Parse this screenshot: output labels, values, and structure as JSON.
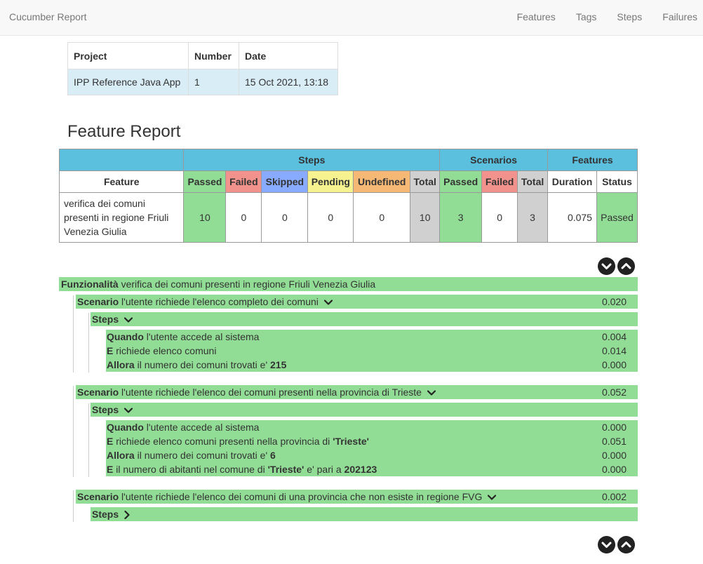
{
  "nav": {
    "brand": "Cucumber Report",
    "links": [
      "Features",
      "Tags",
      "Steps",
      "Failures"
    ]
  },
  "info": {
    "headers": [
      "Project",
      "Number",
      "Date"
    ],
    "row": [
      "IPP Reference Java App",
      "1",
      "15 Oct 2021, 13:18"
    ]
  },
  "report_title": "Feature Report",
  "stats": {
    "groups": [
      "Steps",
      "Scenarios",
      "Features"
    ],
    "headers": [
      "Feature",
      "Passed",
      "Failed",
      "Skipped",
      "Pending",
      "Undefined",
      "Total",
      "Passed",
      "Failed",
      "Total",
      "Duration",
      "Status"
    ],
    "row": [
      "verifica dei comuni presenti in regione Friuli Venezia Giulia",
      "10",
      "0",
      "0",
      "0",
      "0",
      "10",
      "3",
      "0",
      "3",
      "0.075",
      "Passed"
    ]
  },
  "feature": {
    "keyword": "Funzionalità",
    "name": "verifica dei comuni presenti in regione Friuli Venezia Giulia"
  },
  "scenarios": [
    {
      "keyword": "Scenario",
      "name": "l'utente richiede l'elenco completo dei comuni",
      "duration": "0.020",
      "steps_label": "Steps",
      "steps": [
        {
          "keyword": "Quando",
          "text": "l'utente accede al sistema",
          "duration": "0.004"
        },
        {
          "keyword": "E",
          "text": "richiede elenco comuni",
          "duration": "0.014"
        },
        {
          "keyword": "Allora",
          "text": "il numero dei comuni trovati e'",
          "arg": "215",
          "duration": "0.000"
        }
      ]
    },
    {
      "keyword": "Scenario",
      "name": "l'utente richiede l'elenco dei comuni presenti nella provincia di Trieste",
      "duration": "0.052",
      "steps_label": "Steps",
      "steps": [
        {
          "keyword": "Quando",
          "text": "l'utente accede al sistema",
          "duration": "0.000"
        },
        {
          "keyword": "E",
          "text": "richiede elenco comuni presenti nella provincia di",
          "arg": "'Trieste'",
          "duration": "0.051"
        },
        {
          "keyword": "Allora",
          "text": "il numero dei comuni trovati e'",
          "arg": "6",
          "duration": "0.000"
        },
        {
          "keyword": "E",
          "text": "il numero di abitanti nel comune di",
          "arg": "'Trieste'",
          "text2": "e' pari a",
          "arg2": "202123",
          "duration": "0.000"
        }
      ]
    },
    {
      "keyword": "Scenario",
      "name": "l'utente richiede l'elenco dei comuni di una provincia che non esiste in regione FVG",
      "duration": "0.002",
      "steps_label": "Steps"
    }
  ],
  "icons": {
    "expand": "chevron-circle-down-icon",
    "collapse": "chevron-circle-up-icon"
  },
  "colors": {
    "passed": "#92dd96",
    "failed": "#f2928c",
    "skipped": "#88aaff",
    "pending": "#f5f28f",
    "undefined": "#f5b975",
    "total": "#d0d0d0",
    "header": "#5bc0de"
  }
}
